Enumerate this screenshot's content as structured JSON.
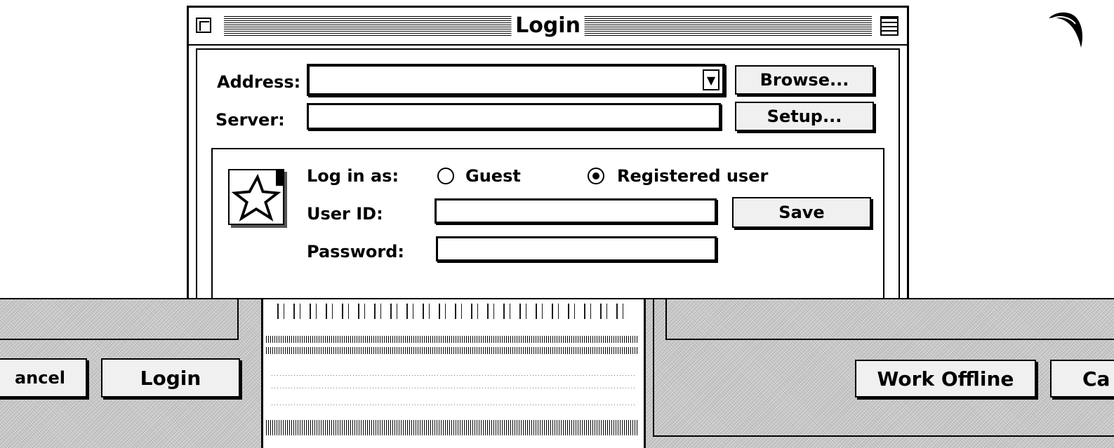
{
  "window": {
    "title": "Login"
  },
  "address": {
    "label": "Address:",
    "value": "",
    "browse_label": "Browse..."
  },
  "server": {
    "label": "Server:",
    "value": "",
    "setup_label": "Setup..."
  },
  "login_as": {
    "label": "Log in as:",
    "options": [
      "Guest",
      "Registered user"
    ],
    "selected": "Registered user"
  },
  "user_id": {
    "label": "User ID:",
    "value": "",
    "save_label": "Save"
  },
  "password": {
    "label": "Password:",
    "value": ""
  },
  "footer_left": {
    "cancel_label": "ancel",
    "login_label": "Login"
  },
  "footer_right": {
    "work_offline_label": "Work Offline",
    "cancel_label": "Ca"
  },
  "icons": {
    "close": "close-box-icon",
    "zoom": "zoom-box-icon",
    "dropdown": "dropdown-arrow-icon",
    "star": "star-icon",
    "moon": "moon-icon"
  }
}
